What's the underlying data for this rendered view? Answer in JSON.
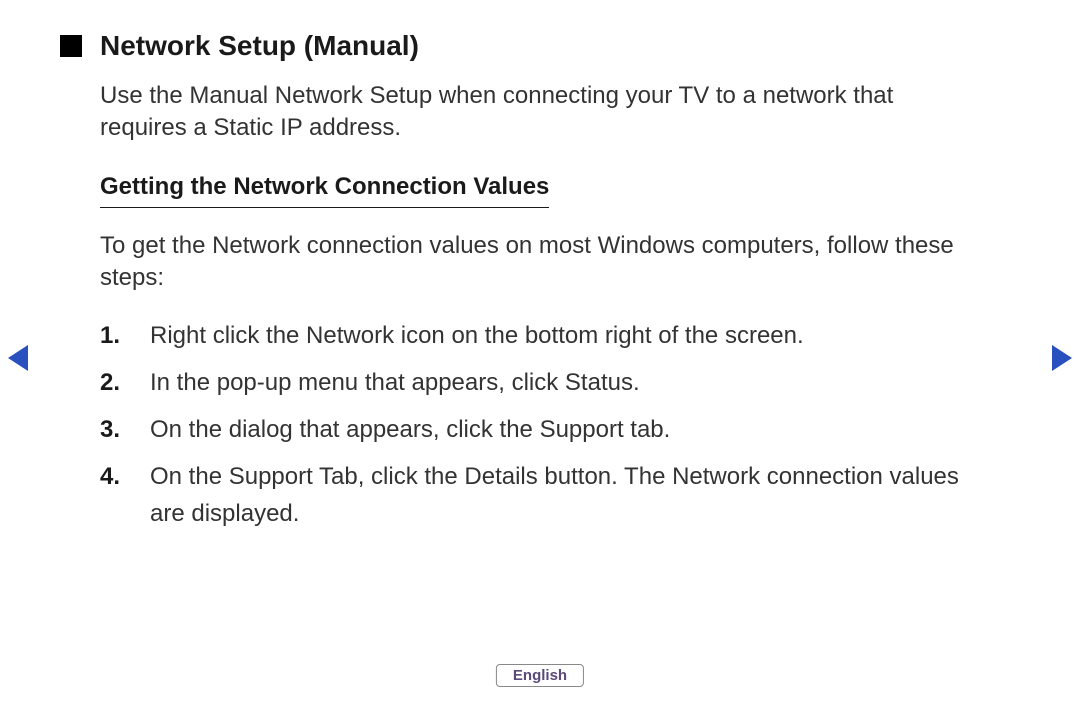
{
  "title": "Network Setup (Manual)",
  "intro": "Use the Manual Network Setup when connecting your TV to a network that requires a Static IP address.",
  "subhead": "Getting the Network Connection Values",
  "lead": "To get the Network connection values on most Windows computers, follow these steps:",
  "steps": [
    "Right click the Network icon on the bottom right of the screen.",
    "In the pop-up menu that appears, click Status.",
    "On the dialog that appears, click the Support tab.",
    "On the Support Tab, click the Details button. The Network connection values are displayed."
  ],
  "language": "English"
}
